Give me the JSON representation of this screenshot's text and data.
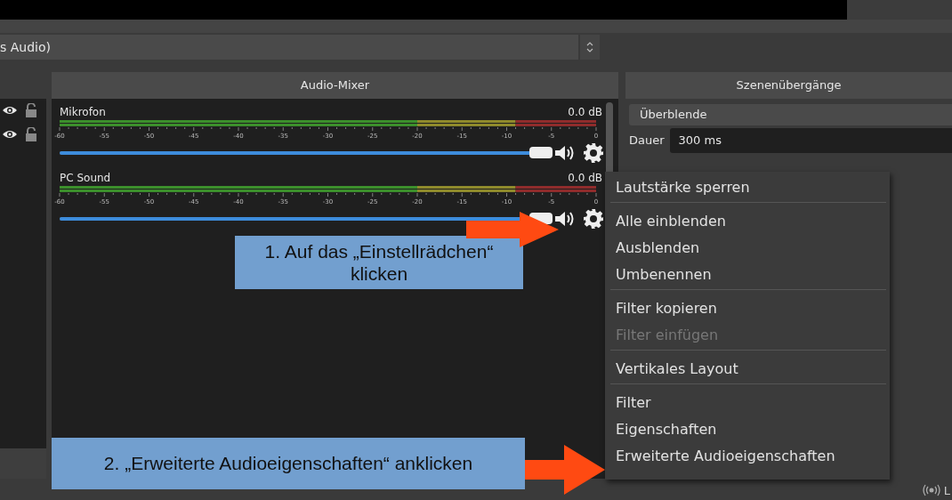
{
  "source_select": {
    "value": "s Audio)"
  },
  "sources": [
    {
      "visible": true,
      "locked": false
    },
    {
      "visible": true,
      "locked": false
    }
  ],
  "audio_mixer": {
    "title": "Audio-Mixer",
    "channels": [
      {
        "name": "Mikrofon",
        "reading": "0.0 dB",
        "scale": [
          "-60",
          "-55",
          "-50",
          "-45",
          "-40",
          "-35",
          "-30",
          "-25",
          "-20",
          "-15",
          "-10",
          "-5",
          "0"
        ],
        "level": 1.0
      },
      {
        "name": "PC Sound",
        "reading": "0.0 dB",
        "scale": [
          "-60",
          "-55",
          "-50",
          "-45",
          "-40",
          "-35",
          "-30",
          "-25",
          "-20",
          "-15",
          "-10",
          "-5",
          "0"
        ],
        "level": 1.0
      }
    ]
  },
  "transitions": {
    "title": "Szenenübergänge",
    "transition": "Überblende",
    "duration_label": "Dauer",
    "duration": "300 ms"
  },
  "context_menu": {
    "groups": [
      [
        {
          "label": "Lautstärke sperren",
          "disabled": false
        }
      ],
      [
        {
          "label": "Alle einblenden",
          "disabled": false
        },
        {
          "label": "Ausblenden",
          "disabled": false
        },
        {
          "label": "Umbenennen",
          "disabled": false
        }
      ],
      [
        {
          "label": "Filter kopieren",
          "disabled": false
        },
        {
          "label": "Filter einfügen",
          "disabled": true
        }
      ],
      [
        {
          "label": "Vertikales Layout",
          "disabled": false
        }
      ],
      [
        {
          "label": "Filter",
          "disabled": false
        },
        {
          "label": "Eigenschaften",
          "disabled": false
        },
        {
          "label": "Erweiterte Audioeigenschaften",
          "disabled": false
        }
      ]
    ]
  },
  "annotations": [
    {
      "text": "1. Auf das „Einstellrädchen“ klicken"
    },
    {
      "text": "2. „Erweiterte Audioeigenschaften“ anklicken"
    }
  ],
  "status_bar": {
    "text": "L"
  }
}
